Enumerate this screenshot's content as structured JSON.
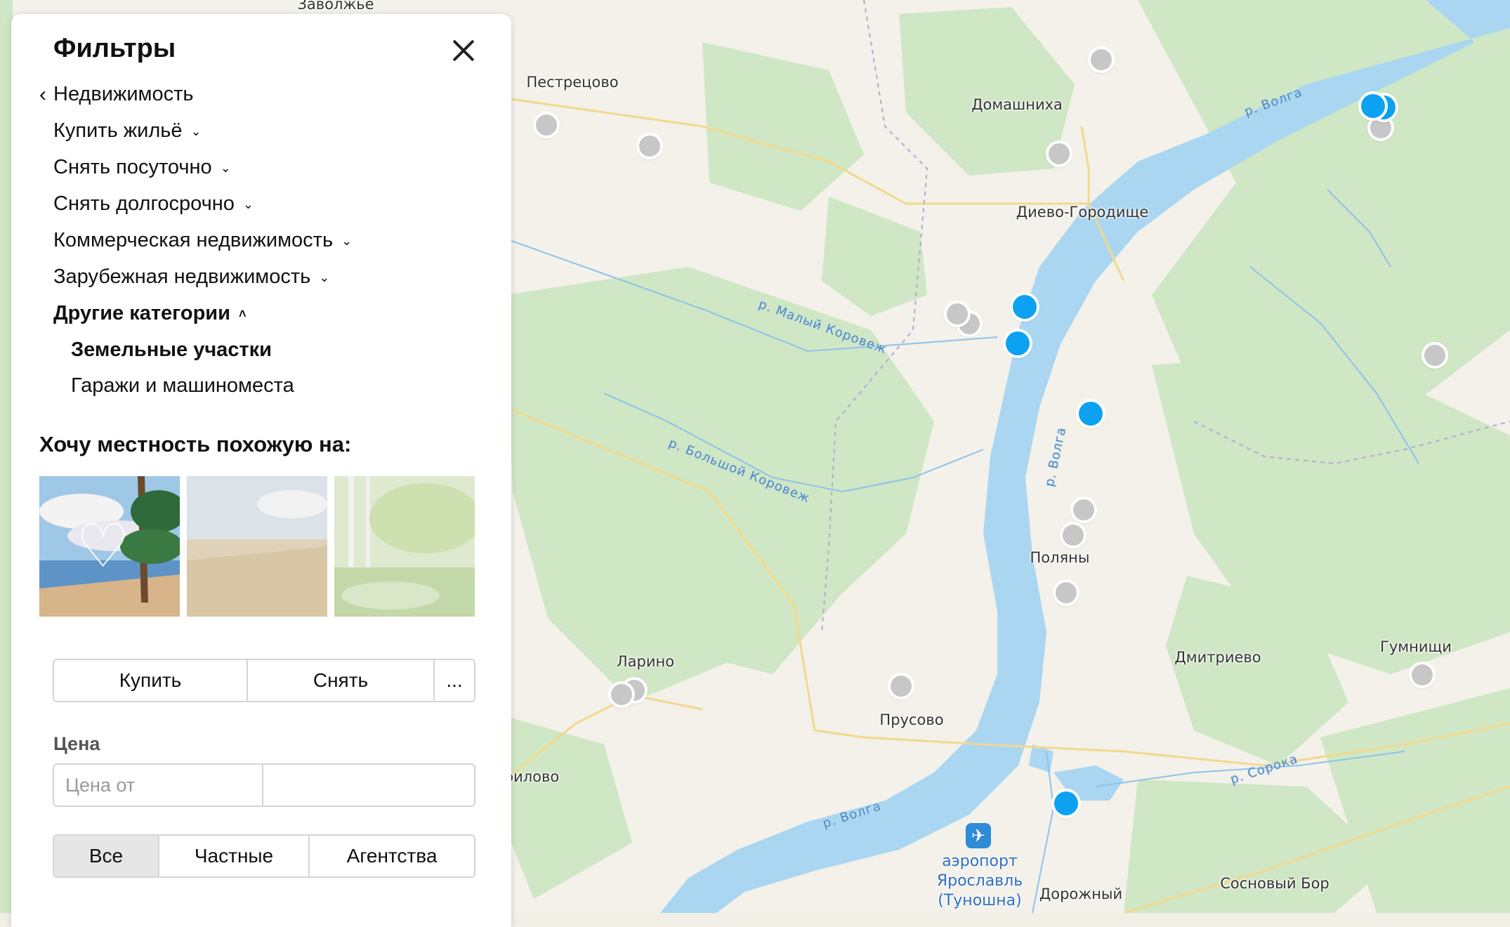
{
  "map": {
    "towns": [
      "Заволжье",
      "Пестрецово",
      "Домашниха",
      "Диево-Городище",
      "Поляны",
      "Ларино",
      "Прусово",
      "Дмитриево",
      "Гумнищи",
      "Сосновый Бор",
      "Дорожный",
      "рилово"
    ],
    "rivers": [
      "р. Волга",
      "р. Малый Коровеж",
      "р. Большой Коровеж",
      "р. Сорока"
    ],
    "airport": {
      "line1": "аэропорт",
      "line2": "Ярославль",
      "line3": "(Туношна)",
      "icon": "airplane-icon"
    }
  },
  "panel": {
    "title": "Фильтры",
    "back_label": "Недвижимость",
    "categories": [
      {
        "label": "Купить жильё"
      },
      {
        "label": "Снять посуточно"
      },
      {
        "label": "Снять долгосрочно"
      },
      {
        "label": "Коммерческая недвижимость"
      },
      {
        "label": "Зарубежная недвижимость"
      },
      {
        "label": "Другие категории"
      }
    ],
    "subcategories": [
      {
        "label": "Земельные участки",
        "selected": true
      },
      {
        "label": "Гаражи и машиноместа",
        "selected": false
      }
    ],
    "locality": {
      "title": "Хочу местность похожую на:",
      "images": [
        "seaside-pines",
        "wheat-field",
        "birch-grove"
      ]
    },
    "deal_type": {
      "options": [
        "Купить",
        "Снять",
        "..."
      ]
    },
    "price": {
      "label": "Цена",
      "from_placeholder": "Цена от",
      "to_placeholder": ""
    },
    "seller": {
      "options": [
        "Все",
        "Частные",
        "Агентства"
      ],
      "selected": "Все"
    }
  },
  "colors": {
    "pin_active": "#0da2f1",
    "pin_inactive": "#c7c7c7",
    "water": "#aad6f2",
    "forest": "#cfe7c4"
  }
}
